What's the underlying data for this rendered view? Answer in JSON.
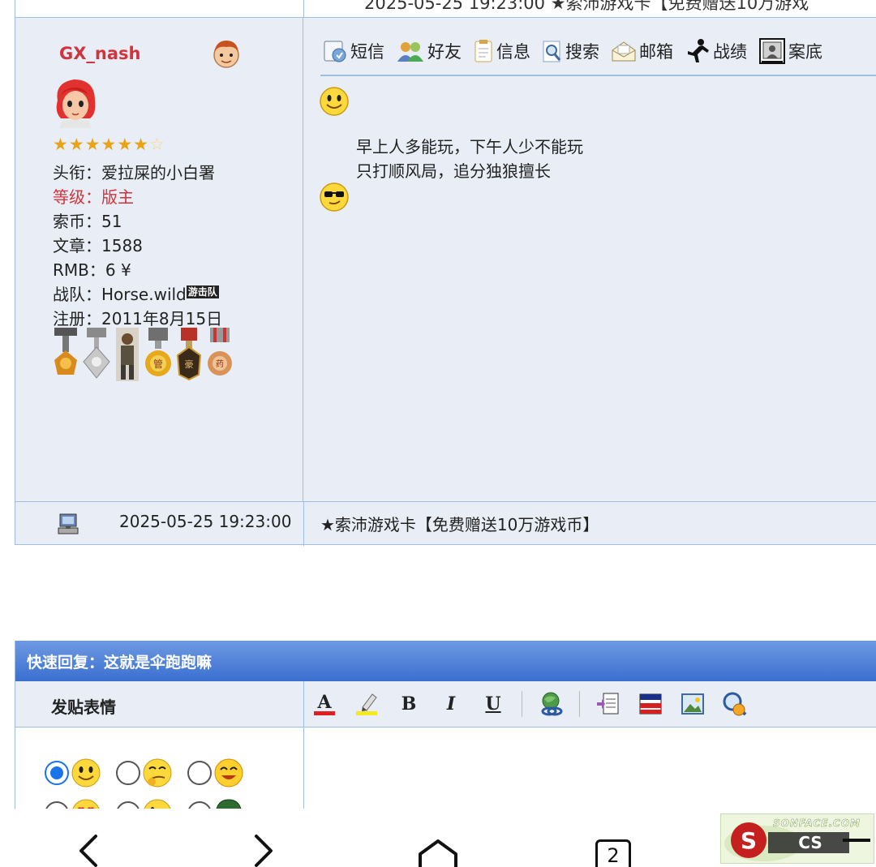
{
  "previous_row": {
    "partial_text": "2025-05-25 19:23:00   ★索沛游戏卡【免费赠送10万游戏"
  },
  "post": {
    "author": {
      "username": "GX_nash",
      "stars_filled": 6,
      "stars_total": 7,
      "title_label": "头衔：",
      "title_value": "爱拉屎的小白署",
      "level_label": "等级：",
      "level_value": "版主",
      "coins_label": "索币：",
      "coins_value": "51",
      "articles_label": "文章：",
      "articles_value": "1588",
      "rmb_label": "RMB：",
      "rmb_value": "6 ¥",
      "team_label": "战队：",
      "team_value": "Horse.wild",
      "team_tag": "游击队",
      "registered_label": "注册：",
      "registered_value": "2011年8月15日"
    },
    "toolbar": [
      {
        "label": "短信",
        "icon": "message-icon"
      },
      {
        "label": "好友",
        "icon": "friends-icon"
      },
      {
        "label": "信息",
        "icon": "info-icon"
      },
      {
        "label": "搜索",
        "icon": "search-icon"
      },
      {
        "label": "邮箱",
        "icon": "mail-icon"
      },
      {
        "label": "战绩",
        "icon": "stats-icon"
      },
      {
        "label": "案底",
        "icon": "record-icon"
      }
    ],
    "body_lines": [
      "早上人多能玩，下午人少不能玩",
      "只打顺风局，追分独狼擅长"
    ],
    "post_time": "2025-05-25 19:23:00",
    "signature": "★索沛游戏卡【免费赠送10万游戏币】"
  },
  "quick_reply": {
    "title": "快速回复：这就是伞跑跑嘛",
    "emoji_label": "发贴表情",
    "selected_emoji_index": 0,
    "editor_tools": [
      "font-color-icon",
      "highlight-icon",
      "bold-icon",
      "italic-icon",
      "underline-icon",
      "link-icon",
      "insert-file-icon",
      "flag-icon",
      "image-icon",
      "user-search-icon"
    ],
    "bold_label": "B",
    "italic_label": "I",
    "underline_label": "U"
  },
  "navbar": {
    "tab_count": "2"
  },
  "watermark": {
    "text": "SONFACE.COM"
  },
  "colors": {
    "username_red": "#d0343c",
    "post_bg": "#e9eef6",
    "border_blue": "#9fbfe0",
    "header_blue": "#3a6fd0",
    "radio_blue": "#1a73e8"
  }
}
